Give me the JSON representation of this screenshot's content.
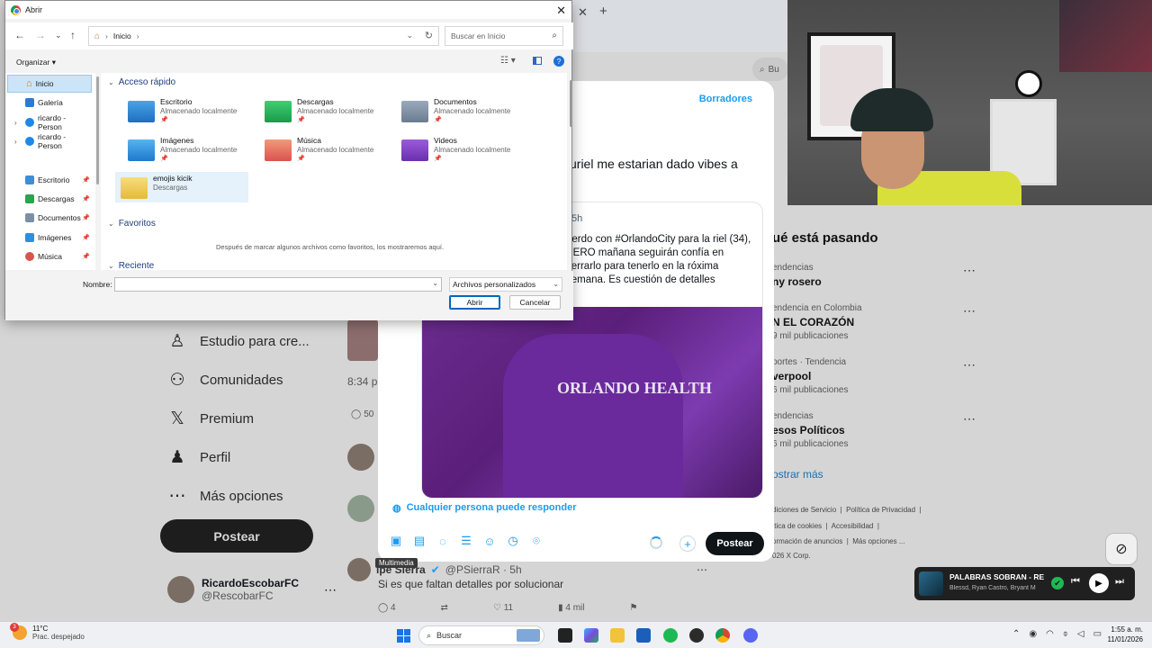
{
  "dialog": {
    "title": "Abrir",
    "address": [
      "Inicio"
    ],
    "search_placeholder": "Buscar en Inicio",
    "organize_label": "Organizar",
    "sidebar": [
      {
        "label": "Inicio",
        "icon": "home-icon",
        "selected": true
      },
      {
        "label": "Galería",
        "icon": "gallery-icon"
      },
      {
        "label": "ricardo - Person",
        "icon": "onedrive-icon"
      },
      {
        "label": "ricardo - Person",
        "icon": "onedrive-icon"
      },
      {
        "label": "Escritorio",
        "icon": "desktop-folder-icon",
        "pinned": true
      },
      {
        "label": "Descargas",
        "icon": "downloads-folder-icon",
        "pinned": true
      },
      {
        "label": "Documentos",
        "icon": "documents-folder-icon",
        "pinned": true
      },
      {
        "label": "Imágenes",
        "icon": "pictures-folder-icon",
        "pinned": true
      },
      {
        "label": "Música",
        "icon": "music-folder-icon",
        "pinned": true
      }
    ],
    "sections": {
      "quick_access": "Acceso rápido",
      "favorites": "Favoritos",
      "recent": "Reciente"
    },
    "quick_access": [
      {
        "name": "Escritorio",
        "location": "Almacenado localmente",
        "icon": "desktop-folder-icon"
      },
      {
        "name": "Descargas",
        "location": "Almacenado localmente",
        "icon": "downloads-folder-icon"
      },
      {
        "name": "Documentos",
        "location": "Almacenado localmente",
        "icon": "documents-folder-icon"
      },
      {
        "name": "Imágenes",
        "location": "Almacenado localmente",
        "icon": "pictures-folder-icon"
      },
      {
        "name": "Música",
        "location": "Almacenado localmente",
        "icon": "music-folder-icon"
      },
      {
        "name": "Videos",
        "location": "Almacenado localmente",
        "icon": "videos-folder-icon"
      },
      {
        "name": "emojis kicik",
        "location": "Descargas",
        "icon": "folder-icon"
      }
    ],
    "favorites_empty": "Después de marcar algunos archivos como favoritos, los mostraremos aquí.",
    "name_label": "Nombre:",
    "name_value": "",
    "filter_value": "Archivos personalizados",
    "open_label": "Abrir",
    "cancel_label": "Cancelar"
  },
  "x_app": {
    "nav": [
      {
        "label": "Estudio para cre...",
        "icon": "studio-icon"
      },
      {
        "label": "Comunidades",
        "icon": "communities-icon"
      },
      {
        "label": "Premium",
        "icon": "x-logo-icon"
      },
      {
        "label": "Perfil",
        "icon": "profile-icon"
      },
      {
        "label": "Más opciones",
        "icon": "more-options-icon"
      }
    ],
    "post_button": "Postear",
    "user_name": "RicardoEscobarFC",
    "user_handle": "@RescobarFC",
    "feed_time": "8:34 p...",
    "feed_count": "50",
    "trends_title": "ué está pasando",
    "trends": [
      {
        "context": "endencias",
        "name": "ny rosero",
        "posts": ""
      },
      {
        "context": "endencia en Colombia",
        "name": "N EL CORAZÓN",
        "posts": "9 mil publicaciones"
      },
      {
        "context": "portes · Tendencia",
        "name": "verpool",
        "posts": "6 mil publicaciones"
      },
      {
        "context": "endencias",
        "name": "esos Políticos",
        "posts": "6 mil publicaciones"
      }
    ],
    "show_more": "ostrar más",
    "footer_links": [
      "diciones de Servicio",
      "Política de Privacidad",
      "ítica de cookies",
      "Accesibilidad",
      "ormación de anuncios",
      "Más opciones ...",
      "026 X Corp."
    ],
    "search_hint": "Bu"
  },
  "compose": {
    "drafts_label": "Borradores",
    "text": "uriel me estarian dado vibes a",
    "quote_time": "5h",
    "quote_text": "uerdo con #OrlandoCity para la riel (34), PERO mañana seguirán confía en cerrarlo para tenerlo en la róxima semana. Es cuestión de detalles",
    "shirt_text": "ORLANDO HEALTH",
    "reply_setting": "Cualquier persona puede responder",
    "post_label": "Postear",
    "tooltip": "Multimedia"
  },
  "feed_reply": {
    "name": "ipe Sierra",
    "handle": "@PSierraR · 5h",
    "text": "Si es que faltan detalles por solucionar",
    "replies": "4",
    "likes": "11",
    "views": "4 mil"
  },
  "player": {
    "song": "PALABRAS SOBRAN - RE",
    "artist": "Blessd, Ryan Castro, Bryant M"
  },
  "taskbar": {
    "temperature": "11°C",
    "weather": "Prac. despejado",
    "weather_badge": "3",
    "search_label": "Buscar",
    "time": "1:55 a. m.",
    "date": "11/01/2026"
  },
  "colors": {
    "x_blue": "#1d9bf0",
    "win_accent": "#0067c0",
    "spotify_green": "#1db954"
  }
}
